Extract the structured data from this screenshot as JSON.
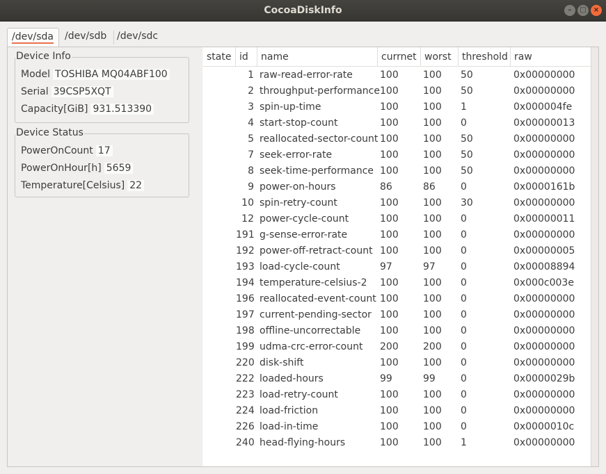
{
  "window": {
    "title": "CocoaDiskInfo"
  },
  "tabs": [
    {
      "label": "/dev/sda"
    },
    {
      "label": "/dev/sdb"
    },
    {
      "label": "/dev/sdc"
    }
  ],
  "device_info": {
    "title": "Device Info",
    "model_label": "Model",
    "model_value": "TOSHIBA MQ04ABF100",
    "serial_label": "Serial",
    "serial_value": "39CSP5XQT",
    "capacity_label": "Capacity[GiB]",
    "capacity_value": "931.513390"
  },
  "device_status": {
    "title": "Device Status",
    "power_on_count_label": "PowerOnCount",
    "power_on_count_value": "17",
    "power_on_hour_label": "PowerOnHour[h]",
    "power_on_hour_value": "5659",
    "temperature_label": "Temperature[Celsius]",
    "temperature_value": "22"
  },
  "table": {
    "headers": [
      "state",
      "id",
      "name",
      "currnet",
      "worst",
      "threshold",
      "raw"
    ],
    "rows": [
      {
        "id": "1",
        "name": "raw-read-error-rate",
        "current": "100",
        "worst": "100",
        "threshold": "50",
        "raw": "0x00000000"
      },
      {
        "id": "2",
        "name": "throughput-performance",
        "current": "100",
        "worst": "100",
        "threshold": "50",
        "raw": "0x00000000"
      },
      {
        "id": "3",
        "name": "spin-up-time",
        "current": "100",
        "worst": "100",
        "threshold": "1",
        "raw": "0x000004fe"
      },
      {
        "id": "4",
        "name": "start-stop-count",
        "current": "100",
        "worst": "100",
        "threshold": "0",
        "raw": "0x00000013"
      },
      {
        "id": "5",
        "name": "reallocated-sector-count",
        "current": "100",
        "worst": "100",
        "threshold": "50",
        "raw": "0x00000000"
      },
      {
        "id": "7",
        "name": "seek-error-rate",
        "current": "100",
        "worst": "100",
        "threshold": "50",
        "raw": "0x00000000"
      },
      {
        "id": "8",
        "name": "seek-time-performance",
        "current": "100",
        "worst": "100",
        "threshold": "50",
        "raw": "0x00000000"
      },
      {
        "id": "9",
        "name": "power-on-hours",
        "current": "86",
        "worst": "86",
        "threshold": "0",
        "raw": "0x0000161b"
      },
      {
        "id": "10",
        "name": "spin-retry-count",
        "current": "100",
        "worst": "100",
        "threshold": "30",
        "raw": "0x00000000"
      },
      {
        "id": "12",
        "name": "power-cycle-count",
        "current": "100",
        "worst": "100",
        "threshold": "0",
        "raw": "0x00000011"
      },
      {
        "id": "191",
        "name": "g-sense-error-rate",
        "current": "100",
        "worst": "100",
        "threshold": "0",
        "raw": "0x00000000"
      },
      {
        "id": "192",
        "name": "power-off-retract-count",
        "current": "100",
        "worst": "100",
        "threshold": "0",
        "raw": "0x00000005"
      },
      {
        "id": "193",
        "name": "load-cycle-count",
        "current": "97",
        "worst": "97",
        "threshold": "0",
        "raw": "0x00008894"
      },
      {
        "id": "194",
        "name": "temperature-celsius-2",
        "current": "100",
        "worst": "100",
        "threshold": "0",
        "raw": "0x000c003e"
      },
      {
        "id": "196",
        "name": "reallocated-event-count",
        "current": "100",
        "worst": "100",
        "threshold": "0",
        "raw": "0x00000000"
      },
      {
        "id": "197",
        "name": "current-pending-sector",
        "current": "100",
        "worst": "100",
        "threshold": "0",
        "raw": "0x00000000"
      },
      {
        "id": "198",
        "name": "offline-uncorrectable",
        "current": "100",
        "worst": "100",
        "threshold": "0",
        "raw": "0x00000000"
      },
      {
        "id": "199",
        "name": "udma-crc-error-count",
        "current": "200",
        "worst": "200",
        "threshold": "0",
        "raw": "0x00000000"
      },
      {
        "id": "220",
        "name": "disk-shift",
        "current": "100",
        "worst": "100",
        "threshold": "0",
        "raw": "0x00000000"
      },
      {
        "id": "222",
        "name": "loaded-hours",
        "current": "99",
        "worst": "99",
        "threshold": "0",
        "raw": "0x0000029b"
      },
      {
        "id": "223",
        "name": "load-retry-count",
        "current": "100",
        "worst": "100",
        "threshold": "0",
        "raw": "0x00000000"
      },
      {
        "id": "224",
        "name": "load-friction",
        "current": "100",
        "worst": "100",
        "threshold": "0",
        "raw": "0x00000000"
      },
      {
        "id": "226",
        "name": "load-in-time",
        "current": "100",
        "worst": "100",
        "threshold": "0",
        "raw": "0x0000010c"
      },
      {
        "id": "240",
        "name": "head-flying-hours",
        "current": "100",
        "worst": "100",
        "threshold": "1",
        "raw": "0x00000000"
      }
    ]
  }
}
